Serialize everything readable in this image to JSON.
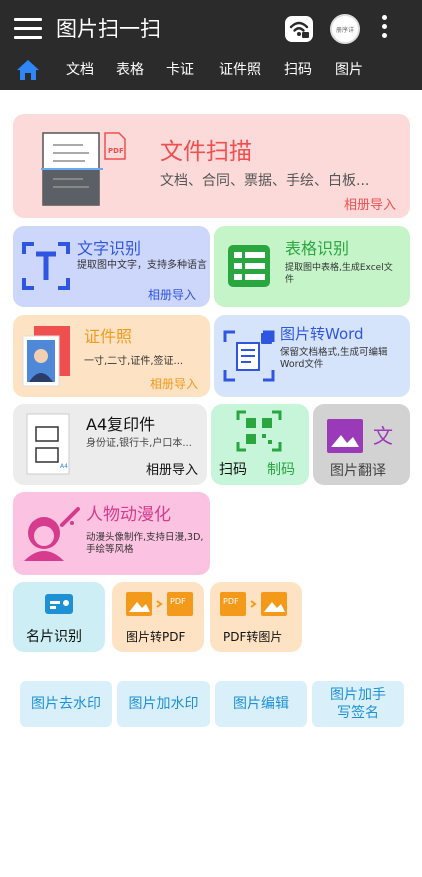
{
  "header": {
    "title": "图片扫一扫",
    "avatar_text": "册序详",
    "tabs": [
      "文档",
      "表格",
      "卡证",
      "证件照",
      "扫码",
      "图片"
    ]
  },
  "doc_scan": {
    "title": "文件扫描",
    "subtitle": "文档、合同、票据、手绘、白板...",
    "import_label": "相册导入",
    "pdf_badge": "PDF"
  },
  "text_ocr": {
    "title": "文字识别",
    "desc": "提取图中文字，支持多种语言",
    "import_label": "相册导入"
  },
  "table_ocr": {
    "title": "表格识别",
    "desc": "提取图中表格,生成Excel文件"
  },
  "id_photo": {
    "title": "证件照",
    "desc": "一寸,二寸,证件,签证...",
    "import_label": "相册导入"
  },
  "img_to_word": {
    "title": "图片转Word",
    "desc": "保留文档格式,生成可编辑Word文件"
  },
  "a4_copy": {
    "title": "A4复印件",
    "desc": "身份证,银行卡,户口本...",
    "import_label": "相册导入",
    "a4_tag": "A4"
  },
  "qr": {
    "scan_label": "扫码",
    "make_label": "制码"
  },
  "translate": {
    "title": "图片翻译"
  },
  "anime": {
    "title": "人物动漫化",
    "desc": "动漫头像制作,支持日漫,3D,手绘等风格"
  },
  "card_ocr": {
    "title": "名片识别"
  },
  "img_to_pdf": {
    "title": "图片转PDF",
    "pdf_badge": "PDF"
  },
  "pdf_to_img": {
    "title": "PDF转图片",
    "pdf_badge": "PDF"
  },
  "bottom_tools": [
    "图片去水印",
    "图片加水印",
    "图片编辑",
    "图片加手写签名"
  ],
  "colors": {
    "header_bg": "#2b2b2b",
    "scan_red": "#ef4f4f",
    "ocr_blue": "#2f56e0",
    "table_green": "#2aa640",
    "id_orange": "#f39a1b",
    "anime_pink": "#d63b8d",
    "tool_blue": "#1e90d6"
  }
}
